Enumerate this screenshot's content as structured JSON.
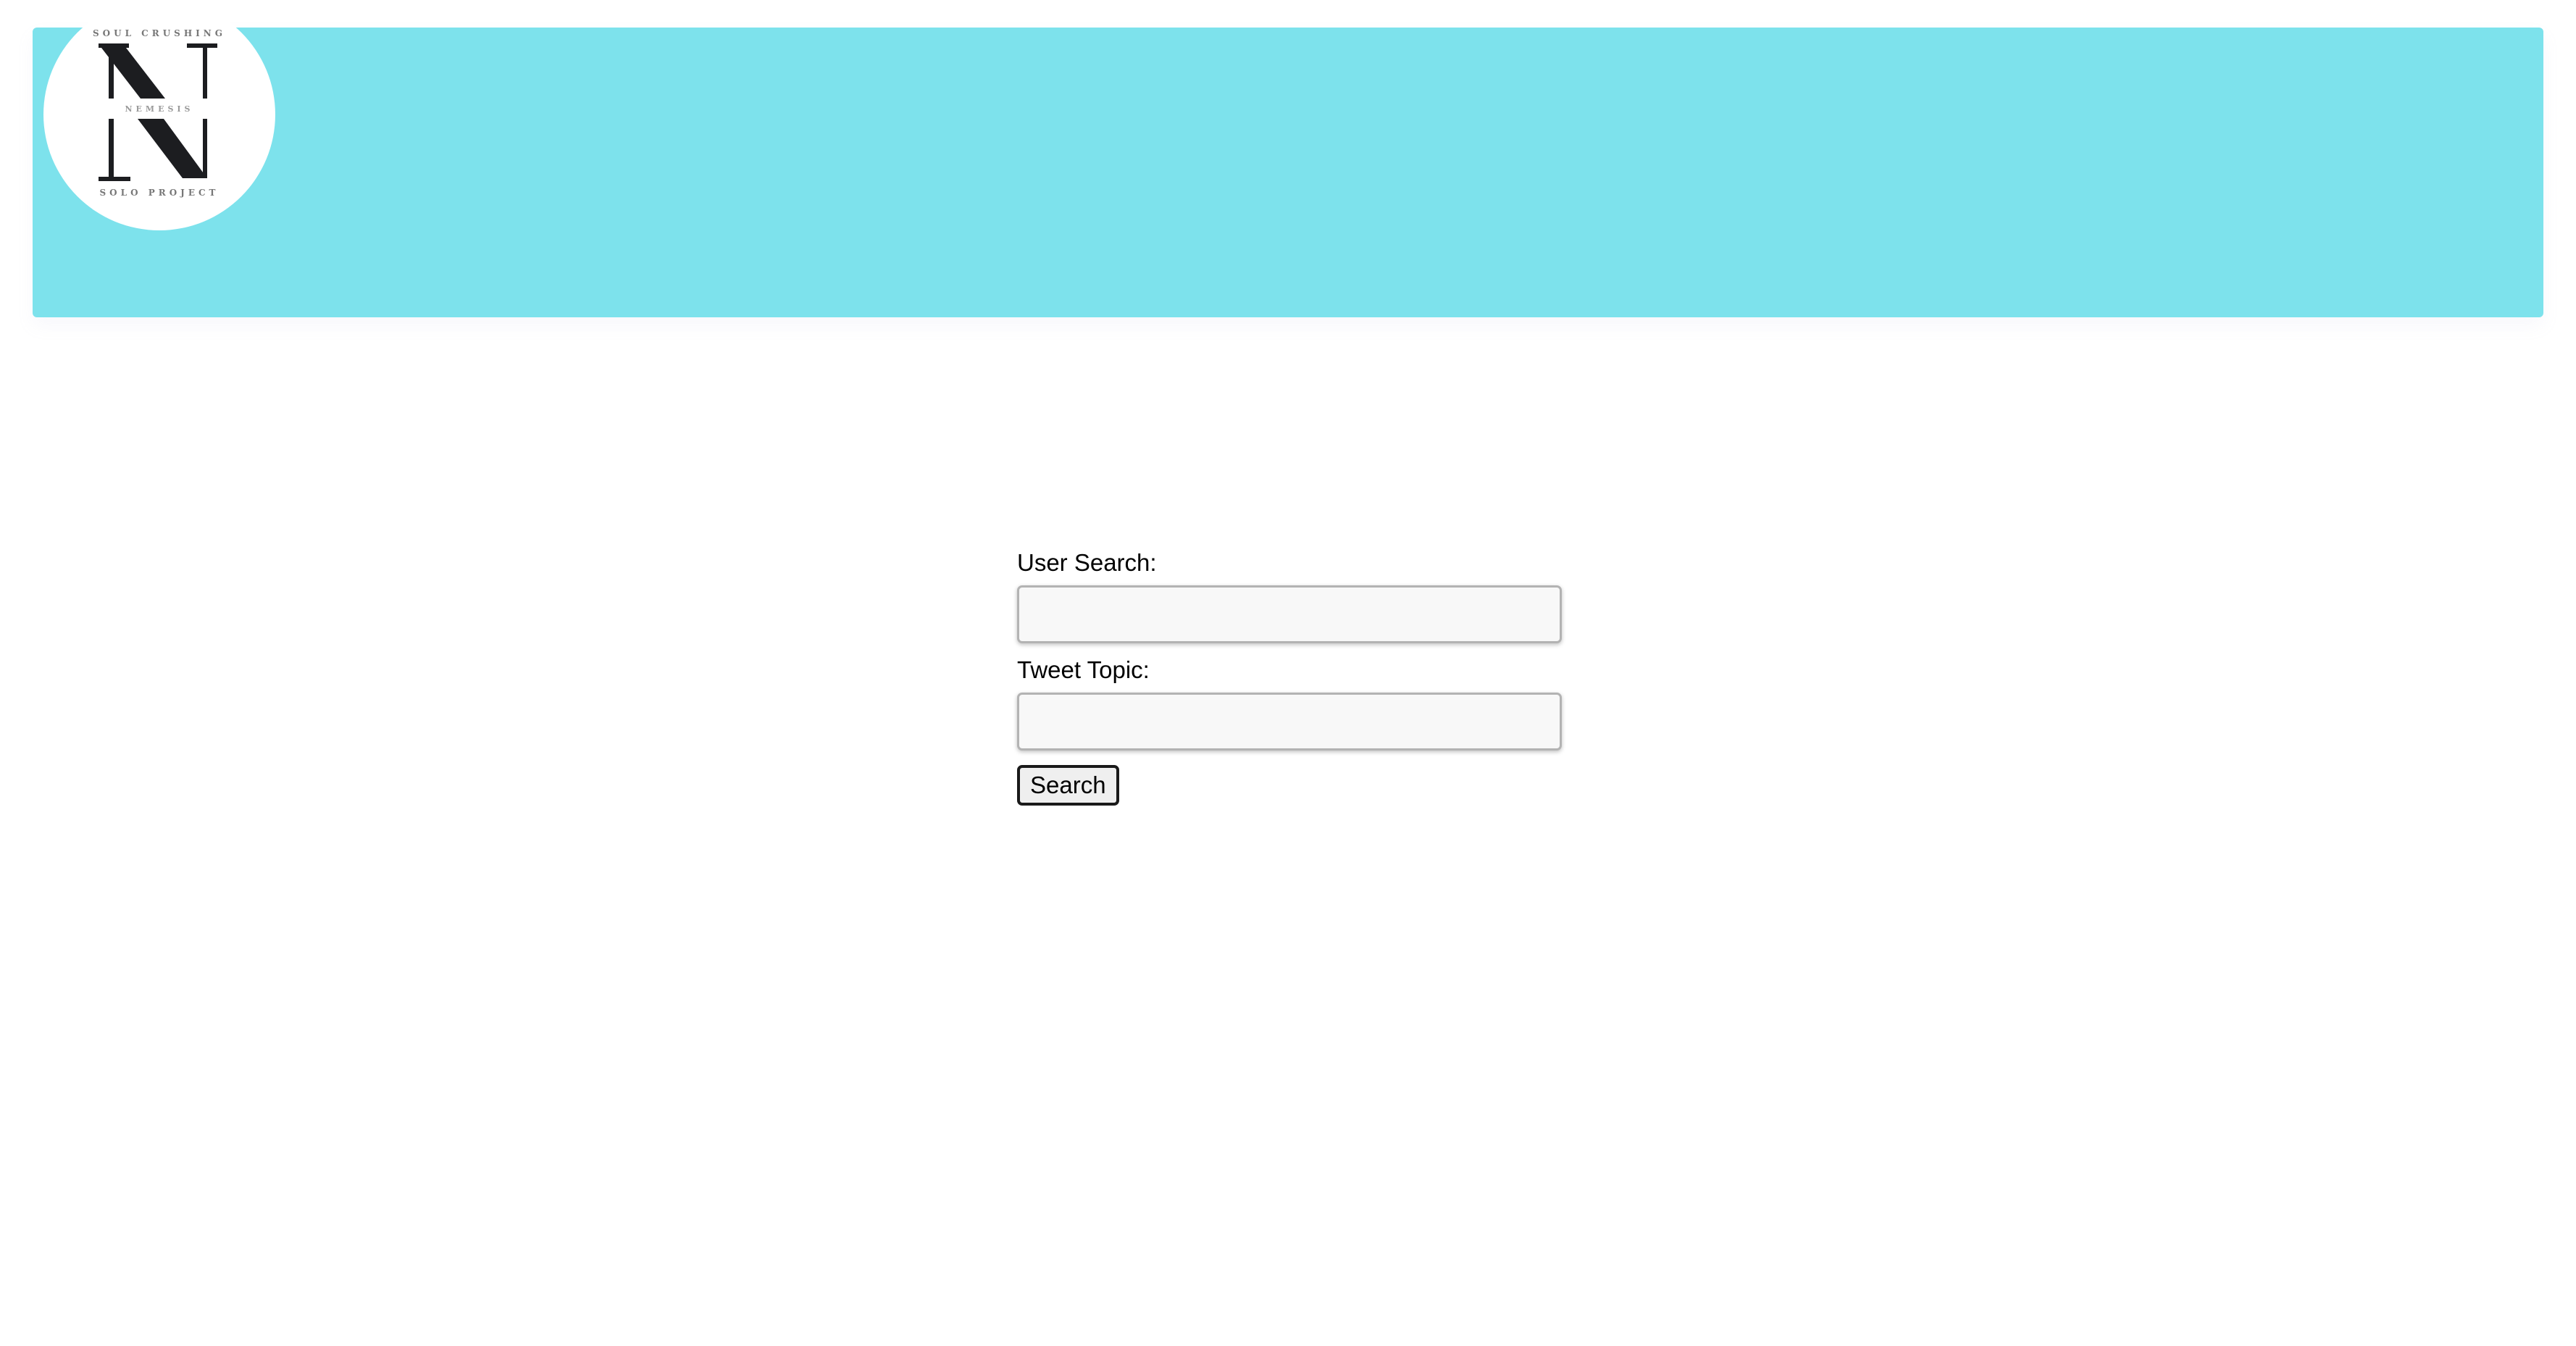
{
  "header": {
    "background_color": "#7de2ec",
    "logo": {
      "top_text": "SOUL CRUSHING",
      "middle_text": "NEMESIS",
      "bottom_text": "SOLO PROJECT"
    }
  },
  "form": {
    "user_search_label": "User Search:",
    "user_search_value": "",
    "tweet_topic_label": "Tweet Topic:",
    "tweet_topic_value": "",
    "search_button_label": "Search"
  }
}
